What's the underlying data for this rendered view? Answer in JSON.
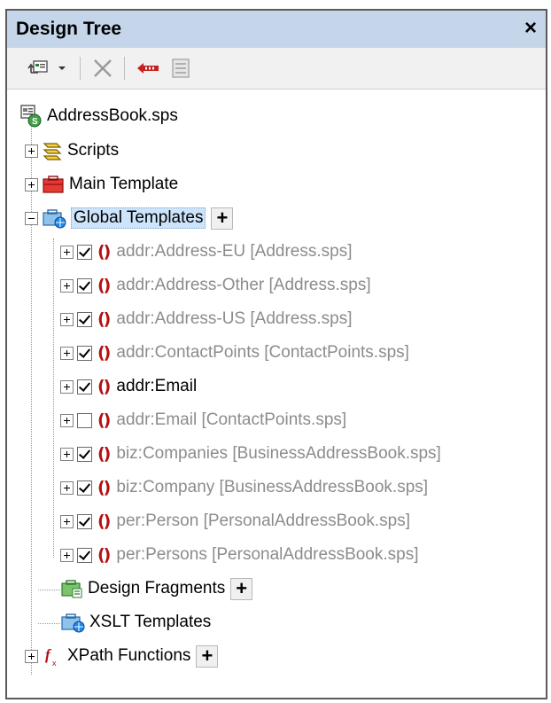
{
  "panel": {
    "title": "Design Tree",
    "close_label": "×"
  },
  "toolbar": {
    "buttons": [
      {
        "name": "add-template-button",
        "icon": "add-template-icon"
      },
      {
        "name": "dropdown-button",
        "icon": "chevron-down-icon"
      },
      {
        "name": "delete-button",
        "icon": "delete-icon"
      },
      {
        "name": "remove-button",
        "icon": "remove-icon"
      },
      {
        "name": "properties-button",
        "icon": "properties-icon"
      }
    ]
  },
  "tree": {
    "root": "AddressBook.sps",
    "scripts": "Scripts",
    "main_template": "Main Template",
    "global_templates": "Global Templates",
    "design_fragments": "Design Fragments",
    "xslt_templates": "XSLT Templates",
    "xpath_functions": "XPath Functions",
    "add_label": "+",
    "global_items": [
      {
        "label": "addr:Address-EU [Address.sps]",
        "checked": true,
        "imported": true
      },
      {
        "label": "addr:Address-Other [Address.sps]",
        "checked": true,
        "imported": true
      },
      {
        "label": "addr:Address-US [Address.sps]",
        "checked": true,
        "imported": true
      },
      {
        "label": "addr:ContactPoints [ContactPoints.sps]",
        "checked": true,
        "imported": true
      },
      {
        "label": "addr:Email",
        "checked": true,
        "imported": false
      },
      {
        "label": "addr:Email [ContactPoints.sps]",
        "checked": false,
        "imported": true
      },
      {
        "label": "biz:Companies [BusinessAddressBook.sps]",
        "checked": true,
        "imported": true
      },
      {
        "label": "biz:Company [BusinessAddressBook.sps]",
        "checked": true,
        "imported": true
      },
      {
        "label": "per:Person [PersonalAddressBook.sps]",
        "checked": true,
        "imported": true
      },
      {
        "label": "per:Persons [PersonalAddressBook.sps]",
        "checked": true,
        "imported": true
      }
    ],
    "template_bracket": "()"
  },
  "colors": {
    "title_bar": "#c5d6ea",
    "selection": "#cde4fb",
    "bracket": "#b31111",
    "imported_text": "#8c8c8c"
  }
}
